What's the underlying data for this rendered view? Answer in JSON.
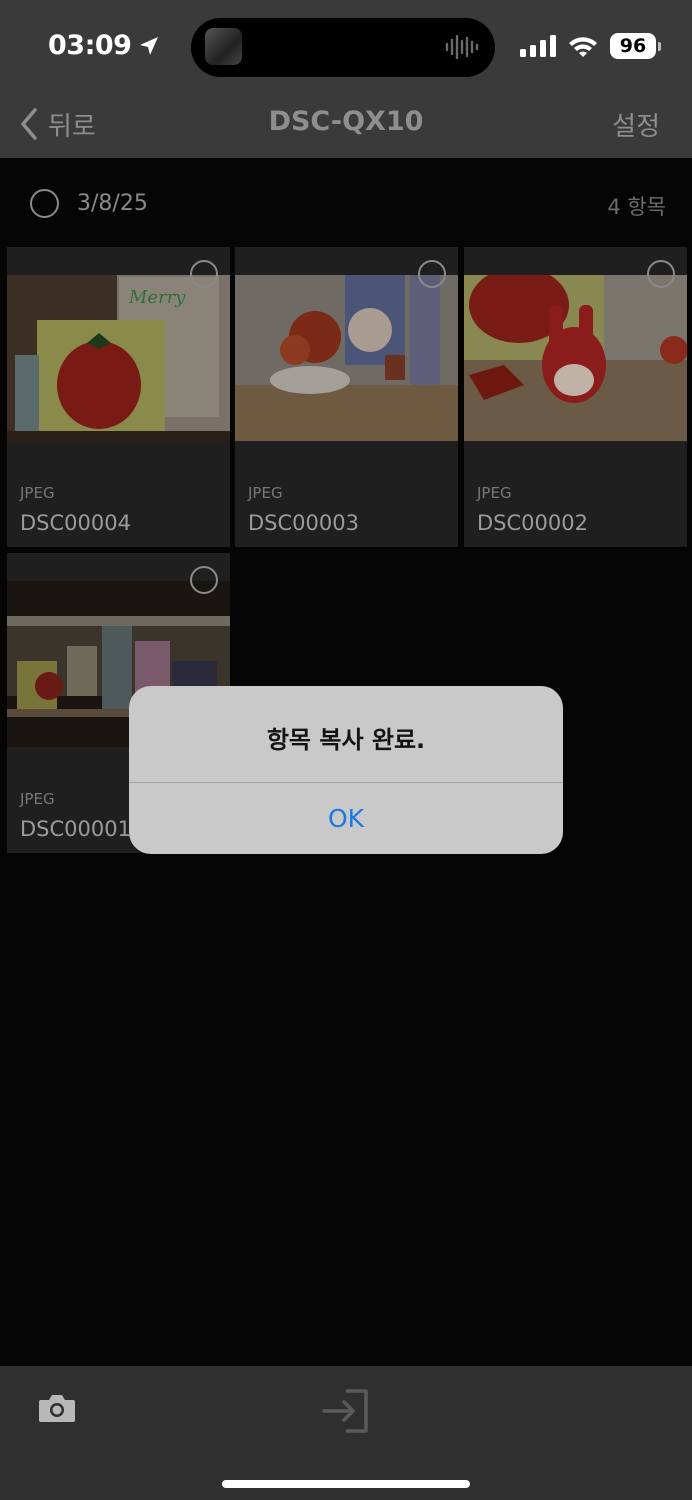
{
  "status": {
    "time": "03:09",
    "battery": "96"
  },
  "nav": {
    "back_label": "뒤로",
    "title": "DSC-QX10",
    "settings_label": "설정"
  },
  "group": {
    "date": "3/8/25",
    "count": "4 항목"
  },
  "photos": [
    {
      "type": "JPEG",
      "name": "DSC00004"
    },
    {
      "type": "JPEG",
      "name": "DSC00003"
    },
    {
      "type": "JPEG",
      "name": "DSC00002"
    },
    {
      "type": "JPEG",
      "name": "DSC00001"
    }
  ],
  "dialog": {
    "message": "항목 복사 완료.",
    "ok_label": "OK"
  },
  "bottom_bar": {
    "icons": [
      "camera-icon",
      "import-icon"
    ]
  }
}
